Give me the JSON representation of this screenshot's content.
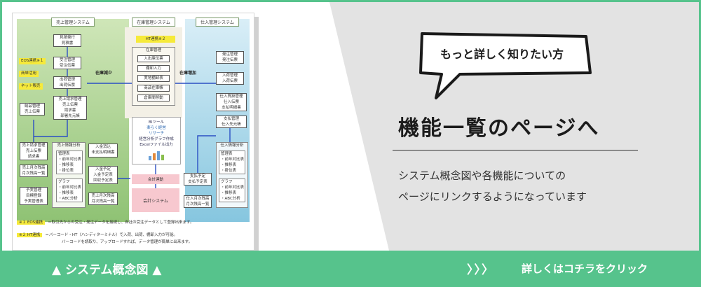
{
  "diagram": {
    "col_sales_title": "売上管理システム",
    "col_stock_title": "在庫管理システム",
    "col_buy_title": "仕入管理システム",
    "ht_tag": "HT連携※２",
    "eos_tag": "EOS連携※１",
    "tag_fax": "商単活用",
    "tag_net": "ネット販売",
    "arrow_stock_down": "在庫減少",
    "arrow_stock_up": "在庫増加",
    "sales": {
      "estimate": [
        "見積発行",
        "見積書"
      ],
      "order": [
        "受注管理",
        "受注伝票"
      ],
      "ship": [
        "出荷管理",
        "出荷伝票"
      ],
      "delivery": [
        "納品管理",
        "売上伝票"
      ],
      "billing": [
        "売上請求管理",
        "売上伝票",
        "請求書",
        "部署先元帳"
      ],
      "seikyu": [
        "売上請求管理",
        "売上伝票",
        "請求書"
      ],
      "monthly": [
        "売上月次残高",
        "月次残高一覧"
      ],
      "yosan": [
        "予実管理",
        "目標登録",
        "予実管理表"
      ],
      "analysis_title": "売上情報分析",
      "kanri": [
        "管理表",
        "・前年対比表",
        "・推移表",
        "・掛位表"
      ],
      "graph": [
        "グラフ",
        "・前年対比表",
        "・推移表",
        "・ABC分析"
      ],
      "nyukin_yotei": [
        "入金消込",
        "未支払明細書"
      ],
      "nyukin": [
        "入金予定",
        "入金予定表",
        "回収予定表"
      ],
      "uriage_monthly": [
        "売上月次残高",
        "月次残高一覧"
      ]
    },
    "stock": {
      "title": "在庫管理",
      "items": [
        "入出庫伝票",
        "棚卸入力",
        "実地棚卸表",
        "商品在庫帳",
        "倉庫間移動"
      ]
    },
    "bi": {
      "title": "BIツール",
      "line1": "楽らく経営",
      "line2": "リサーチ",
      "line3": "経営分析グラフ作成",
      "line4": "Excelファイル出力"
    },
    "kaikei_link": "会計連動",
    "kaikei_system": "会計システム",
    "buy": {
      "hatchu": [
        "発注管理",
        "発注伝票"
      ],
      "nyuka": [
        "入荷管理",
        "入荷伝票"
      ],
      "shiire": [
        "仕入買掛管理",
        "仕入伝票",
        "支払明細書"
      ],
      "shiharai": [
        "支払管理",
        "仕入先元帳"
      ],
      "analysis_title": "仕入情報分析",
      "kanri": [
        "管理表",
        "・前年対比表",
        "・推移表",
        "・掛位表"
      ],
      "graph": [
        "グラフ",
        "・前年対比表",
        "・推移表",
        "・ABC分析"
      ],
      "yotei": [
        "支払予定",
        "支払予定表"
      ],
      "monthly": [
        "仕入月次残高",
        "月次残高一覧"
      ]
    },
    "note1_label": "※１ EOS連携",
    "note1_text": "＝取引先からの受注・発注データを接続し、自社の受注データとして登録出来ます。",
    "note2_label": "※２ HT連携",
    "note2_text": "＝バーコード・HT（ハンディターミナル）で入荷、出荷、棚卸入力が可能。",
    "note2_text2": "バーコードを読取り、アップロードすれば、データ管理が簡単に出来ます。"
  },
  "bubble": "もっと詳しく知りたい方",
  "title": "機能一覧のページへ",
  "desc_line1": "システム概念図や各機能についての",
  "desc_line2": "ページにリンクするようになっています",
  "bar": {
    "left_label": "▲ システム概念図 ▲",
    "arrows": "〉〉〉",
    "right_label": "詳しくはコチラをクリック"
  },
  "colors": {
    "accent": "#56c38c",
    "background": "#e3e3e3"
  }
}
